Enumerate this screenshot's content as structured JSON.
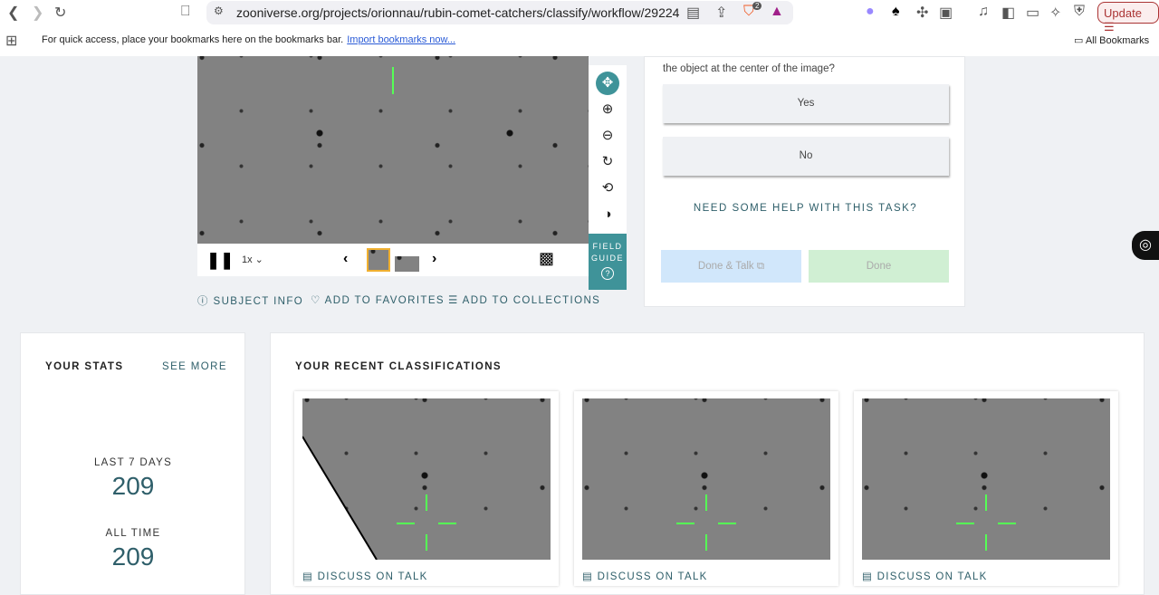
{
  "browser": {
    "url": "zooniverse.org/projects/orionnau/rubin-comet-catchers/classify/workflow/29224",
    "update_label": "Update",
    "brave_badge": "2",
    "bookmarks_msg": "For quick access, place your bookmarks here on the bookmarks bar.",
    "import_link": "Import bookmarks now...",
    "all_bookmarks": "All Bookmarks"
  },
  "viewer": {
    "speed": "1x",
    "field_guide": "FIELD GUIDE",
    "help_glyph": "?"
  },
  "meta": {
    "subject_info": "SUBJECT INFO",
    "favorites": "ADD TO FAVORITES",
    "collections": "ADD TO COLLECTIONS"
  },
  "task": {
    "question": "the object at the center of the image?",
    "answers": [
      "Yes",
      "No"
    ],
    "help": "NEED SOME HELP WITH THIS TASK?",
    "done_talk": "Done & Talk",
    "done": "Done"
  },
  "stats": {
    "title": "YOUR STATS",
    "see_more": "SEE MORE",
    "last7_label": "LAST 7 DAYS",
    "last7_value": "209",
    "all_label": "ALL TIME",
    "all_value": "209"
  },
  "recent": {
    "title": "YOUR RECENT CLASSIFICATIONS",
    "items": [
      {
        "talk": "DISCUSS ON TALK"
      },
      {
        "talk": "DISCUSS ON TALK"
      },
      {
        "talk": "DISCUSS ON TALK"
      }
    ]
  }
}
